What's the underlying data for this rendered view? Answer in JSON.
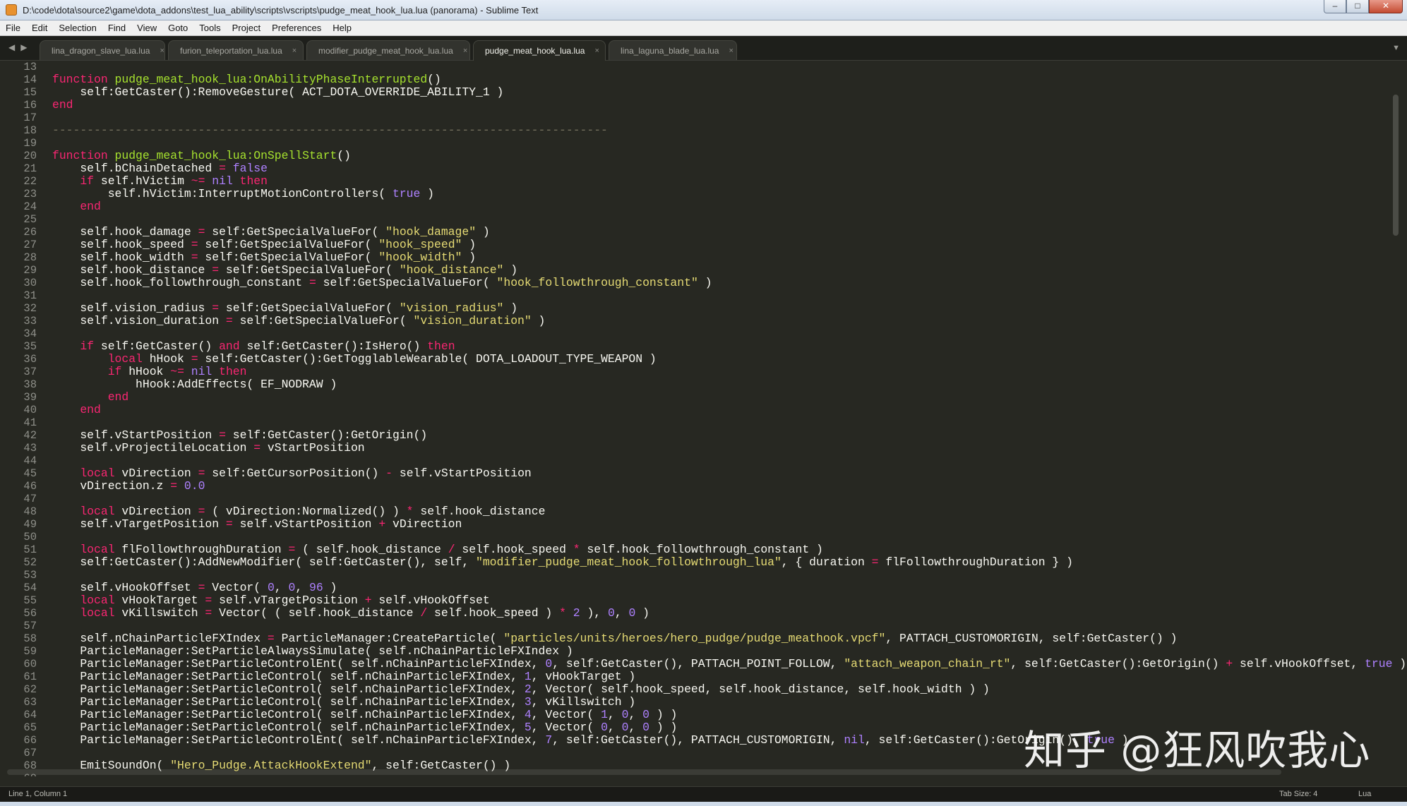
{
  "window": {
    "title": "D:\\code\\dota\\source2\\game\\dota_addons\\test_lua_ability\\scripts\\vscripts\\pudge_meat_hook_lua.lua (panorama) - Sublime Text",
    "minimize": "–",
    "maximize": "□",
    "close": "✕"
  },
  "menu": [
    "File",
    "Edit",
    "Selection",
    "Find",
    "View",
    "Goto",
    "Tools",
    "Project",
    "Preferences",
    "Help"
  ],
  "tabs": [
    {
      "label": "lina_dragon_slave_lua.lua",
      "active": false
    },
    {
      "label": "furion_teleportation_lua.lua",
      "active": false
    },
    {
      "label": "modifier_pudge_meat_hook_lua.lua",
      "active": false
    },
    {
      "label": "pudge_meat_hook_lua.lua",
      "active": true
    },
    {
      "label": "lina_laguna_blade_lua.lua",
      "active": false
    }
  ],
  "tab_close_glyph": "×",
  "tab_nav": {
    "back": "◀",
    "forward": "▶",
    "dropdown": "▼"
  },
  "colors": {
    "background": "#272822",
    "keyword": "#f92672",
    "function": "#a6e22e",
    "string": "#e6db74",
    "number": "#ae81ff",
    "comment": "#75715e",
    "text": "#f8f8f2"
  },
  "code": [
    {
      "n": 13,
      "t": []
    },
    {
      "n": 14,
      "t": [
        [
          "kw",
          "function "
        ],
        [
          "fn",
          "pudge_meat_hook_lua:OnAbilityPhaseInterrupted"
        ],
        [
          "",
          "()"
        ]
      ]
    },
    {
      "n": 15,
      "t": [
        [
          "",
          "    self:GetCaster():RemoveGesture( ACT_DOTA_OVERRIDE_ABILITY_1 )"
        ]
      ]
    },
    {
      "n": 16,
      "t": [
        [
          "kw",
          "end"
        ]
      ]
    },
    {
      "n": 17,
      "t": []
    },
    {
      "n": 18,
      "t": [
        [
          "cmt",
          "--------------------------------------------------------------------------------"
        ]
      ]
    },
    {
      "n": 19,
      "t": []
    },
    {
      "n": 20,
      "t": [
        [
          "kw",
          "function "
        ],
        [
          "fn",
          "pudge_meat_hook_lua:OnSpellStart"
        ],
        [
          "",
          "()"
        ]
      ]
    },
    {
      "n": 21,
      "t": [
        [
          "",
          "    self.bChainDetached "
        ],
        [
          "kw",
          "="
        ],
        [
          "num",
          " false"
        ]
      ]
    },
    {
      "n": 22,
      "t": [
        [
          "kw",
          "    if"
        ],
        [
          "",
          " self.hVictim "
        ],
        [
          "kw",
          "~="
        ],
        [
          "num",
          " nil"
        ],
        [
          "kw",
          " then"
        ]
      ]
    },
    {
      "n": 23,
      "t": [
        [
          "",
          "        self.hVictim:InterruptMotionControllers( "
        ],
        [
          "num",
          "true"
        ],
        [
          "",
          " )"
        ]
      ]
    },
    {
      "n": 24,
      "t": [
        [
          "kw",
          "    end"
        ]
      ]
    },
    {
      "n": 25,
      "t": []
    },
    {
      "n": 26,
      "t": [
        [
          "",
          "    self.hook_damage "
        ],
        [
          "kw",
          "="
        ],
        [
          "",
          " self:GetSpecialValueFor( "
        ],
        [
          "str",
          "\"hook_damage\""
        ],
        [
          "",
          " )"
        ]
      ]
    },
    {
      "n": 27,
      "t": [
        [
          "",
          "    self.hook_speed "
        ],
        [
          "kw",
          "="
        ],
        [
          "",
          " self:GetSpecialValueFor( "
        ],
        [
          "str",
          "\"hook_speed\""
        ],
        [
          "",
          " )"
        ]
      ]
    },
    {
      "n": 28,
      "t": [
        [
          "",
          "    self.hook_width "
        ],
        [
          "kw",
          "="
        ],
        [
          "",
          " self:GetSpecialValueFor( "
        ],
        [
          "str",
          "\"hook_width\""
        ],
        [
          "",
          " )"
        ]
      ]
    },
    {
      "n": 29,
      "t": [
        [
          "",
          "    self.hook_distance "
        ],
        [
          "kw",
          "="
        ],
        [
          "",
          " self:GetSpecialValueFor( "
        ],
        [
          "str",
          "\"hook_distance\""
        ],
        [
          "",
          " )"
        ]
      ]
    },
    {
      "n": 30,
      "t": [
        [
          "",
          "    self.hook_followthrough_constant "
        ],
        [
          "kw",
          "="
        ],
        [
          "",
          " self:GetSpecialValueFor( "
        ],
        [
          "str",
          "\"hook_followthrough_constant\""
        ],
        [
          "",
          " )"
        ]
      ]
    },
    {
      "n": 31,
      "t": []
    },
    {
      "n": 32,
      "t": [
        [
          "",
          "    self.vision_radius "
        ],
        [
          "kw",
          "="
        ],
        [
          "",
          " self:GetSpecialValueFor( "
        ],
        [
          "str",
          "\"vision_radius\""
        ],
        [
          "",
          " )"
        ]
      ]
    },
    {
      "n": 33,
      "t": [
        [
          "",
          "    self.vision_duration "
        ],
        [
          "kw",
          "="
        ],
        [
          "",
          " self:GetSpecialValueFor( "
        ],
        [
          "str",
          "\"vision_duration\""
        ],
        [
          "",
          " )"
        ]
      ]
    },
    {
      "n": 34,
      "t": []
    },
    {
      "n": 35,
      "t": [
        [
          "kw",
          "    if"
        ],
        [
          "",
          " self:GetCaster() "
        ],
        [
          "kw",
          "and"
        ],
        [
          "",
          " self:GetCaster():IsHero() "
        ],
        [
          "kw",
          "then"
        ]
      ]
    },
    {
      "n": 36,
      "t": [
        [
          "kw",
          "        local"
        ],
        [
          "",
          " hHook "
        ],
        [
          "kw",
          "="
        ],
        [
          "",
          " self:GetCaster():GetTogglableWearable( DOTA_LOADOUT_TYPE_WEAPON )"
        ]
      ]
    },
    {
      "n": 37,
      "t": [
        [
          "kw",
          "        if"
        ],
        [
          "",
          " hHook "
        ],
        [
          "kw",
          "~="
        ],
        [
          "num",
          " nil"
        ],
        [
          "kw",
          " then"
        ]
      ]
    },
    {
      "n": 38,
      "t": [
        [
          "",
          "            hHook:AddEffects( EF_NODRAW )"
        ]
      ]
    },
    {
      "n": 39,
      "t": [
        [
          "kw",
          "        end"
        ]
      ]
    },
    {
      "n": 40,
      "t": [
        [
          "kw",
          "    end"
        ]
      ]
    },
    {
      "n": 41,
      "t": []
    },
    {
      "n": 42,
      "t": [
        [
          "",
          "    self.vStartPosition "
        ],
        [
          "kw",
          "="
        ],
        [
          "",
          " self:GetCaster():GetOrigin()"
        ]
      ]
    },
    {
      "n": 43,
      "t": [
        [
          "",
          "    self.vProjectileLocation "
        ],
        [
          "kw",
          "="
        ],
        [
          "",
          " vStartPosition"
        ]
      ]
    },
    {
      "n": 44,
      "t": []
    },
    {
      "n": 45,
      "t": [
        [
          "kw",
          "    local"
        ],
        [
          "",
          " vDirection "
        ],
        [
          "kw",
          "="
        ],
        [
          "",
          " self:GetCursorPosition() "
        ],
        [
          "kw",
          "-"
        ],
        [
          "",
          " self.vStartPosition"
        ]
      ]
    },
    {
      "n": 46,
      "t": [
        [
          "",
          "    vDirection.z "
        ],
        [
          "kw",
          "="
        ],
        [
          "num",
          " 0.0"
        ]
      ]
    },
    {
      "n": 47,
      "t": []
    },
    {
      "n": 48,
      "t": [
        [
          "kw",
          "    local"
        ],
        [
          "",
          " vDirection "
        ],
        [
          "kw",
          "="
        ],
        [
          "",
          " ( vDirection:Normalized() ) "
        ],
        [
          "kw",
          "*"
        ],
        [
          "",
          " self.hook_distance"
        ]
      ]
    },
    {
      "n": 49,
      "t": [
        [
          "",
          "    self.vTargetPosition "
        ],
        [
          "kw",
          "="
        ],
        [
          "",
          " self.vStartPosition "
        ],
        [
          "kw",
          "+"
        ],
        [
          "",
          " vDirection"
        ]
      ]
    },
    {
      "n": 50,
      "t": []
    },
    {
      "n": 51,
      "t": [
        [
          "kw",
          "    local"
        ],
        [
          "",
          " flFollowthroughDuration "
        ],
        [
          "kw",
          "="
        ],
        [
          "",
          " ( self.hook_distance "
        ],
        [
          "kw",
          "/"
        ],
        [
          "",
          " self.hook_speed "
        ],
        [
          "kw",
          "*"
        ],
        [
          "",
          " self.hook_followthrough_constant )"
        ]
      ]
    },
    {
      "n": 52,
      "t": [
        [
          "",
          "    self:GetCaster():AddNewModifier( self:GetCaster(), self, "
        ],
        [
          "str",
          "\"modifier_pudge_meat_hook_followthrough_lua\""
        ],
        [
          "",
          ", { duration "
        ],
        [
          "kw",
          "="
        ],
        [
          "",
          " flFollowthroughDuration } )"
        ]
      ]
    },
    {
      "n": 53,
      "t": []
    },
    {
      "n": 54,
      "t": [
        [
          "",
          "    self.vHookOffset "
        ],
        [
          "kw",
          "="
        ],
        [
          "",
          " Vector( "
        ],
        [
          "num",
          "0"
        ],
        [
          "",
          ", "
        ],
        [
          "num",
          "0"
        ],
        [
          "",
          ", "
        ],
        [
          "num",
          "96"
        ],
        [
          "",
          " )"
        ]
      ]
    },
    {
      "n": 55,
      "t": [
        [
          "kw",
          "    local"
        ],
        [
          "",
          " vHookTarget "
        ],
        [
          "kw",
          "="
        ],
        [
          "",
          " self.vTargetPosition "
        ],
        [
          "kw",
          "+"
        ],
        [
          "",
          " self.vHookOffset"
        ]
      ]
    },
    {
      "n": 56,
      "t": [
        [
          "kw",
          "    local"
        ],
        [
          "",
          " vKillswitch "
        ],
        [
          "kw",
          "="
        ],
        [
          "",
          " Vector( ( self.hook_distance "
        ],
        [
          "kw",
          "/"
        ],
        [
          "",
          " self.hook_speed ) "
        ],
        [
          "kw",
          "*"
        ],
        [
          "num",
          " 2"
        ],
        [
          "",
          " ), "
        ],
        [
          "num",
          "0"
        ],
        [
          "",
          ", "
        ],
        [
          "num",
          "0"
        ],
        [
          "",
          " )"
        ]
      ]
    },
    {
      "n": 57,
      "t": []
    },
    {
      "n": 58,
      "t": [
        [
          "",
          "    self.nChainParticleFXIndex "
        ],
        [
          "kw",
          "="
        ],
        [
          "",
          " ParticleManager:CreateParticle( "
        ],
        [
          "str",
          "\"particles/units/heroes/hero_pudge/pudge_meathook.vpcf\""
        ],
        [
          "",
          ", PATTACH_CUSTOMORIGIN, self:GetCaster() )"
        ]
      ]
    },
    {
      "n": 59,
      "t": [
        [
          "",
          "    ParticleManager:SetParticleAlwaysSimulate( self.nChainParticleFXIndex )"
        ]
      ]
    },
    {
      "n": 60,
      "t": [
        [
          "",
          "    ParticleManager:SetParticleControlEnt( self.nChainParticleFXIndex, "
        ],
        [
          "num",
          "0"
        ],
        [
          "",
          ", self:GetCaster(), PATTACH_POINT_FOLLOW, "
        ],
        [
          "str",
          "\"attach_weapon_chain_rt\""
        ],
        [
          "",
          ", self:GetCaster():GetOrigin() "
        ],
        [
          "kw",
          "+"
        ],
        [
          "",
          " self.vHookOffset, "
        ],
        [
          "num",
          "true"
        ],
        [
          "",
          " )"
        ]
      ]
    },
    {
      "n": 61,
      "t": [
        [
          "",
          "    ParticleManager:SetParticleControl( self.nChainParticleFXIndex, "
        ],
        [
          "num",
          "1"
        ],
        [
          "",
          ", vHookTarget )"
        ]
      ]
    },
    {
      "n": 62,
      "t": [
        [
          "",
          "    ParticleManager:SetParticleControl( self.nChainParticleFXIndex, "
        ],
        [
          "num",
          "2"
        ],
        [
          "",
          ", Vector( self.hook_speed, self.hook_distance, self.hook_width ) )"
        ]
      ]
    },
    {
      "n": 63,
      "t": [
        [
          "",
          "    ParticleManager:SetParticleControl( self.nChainParticleFXIndex, "
        ],
        [
          "num",
          "3"
        ],
        [
          "",
          ", vKillswitch )"
        ]
      ]
    },
    {
      "n": 64,
      "t": [
        [
          "",
          "    ParticleManager:SetParticleControl( self.nChainParticleFXIndex, "
        ],
        [
          "num",
          "4"
        ],
        [
          "",
          ", Vector( "
        ],
        [
          "num",
          "1"
        ],
        [
          "",
          ", "
        ],
        [
          "num",
          "0"
        ],
        [
          "",
          ", "
        ],
        [
          "num",
          "0"
        ],
        [
          "",
          " ) )"
        ]
      ]
    },
    {
      "n": 65,
      "t": [
        [
          "",
          "    ParticleManager:SetParticleControl( self.nChainParticleFXIndex, "
        ],
        [
          "num",
          "5"
        ],
        [
          "",
          ", Vector( "
        ],
        [
          "num",
          "0"
        ],
        [
          "",
          ", "
        ],
        [
          "num",
          "0"
        ],
        [
          "",
          ", "
        ],
        [
          "num",
          "0"
        ],
        [
          "",
          " ) )"
        ]
      ]
    },
    {
      "n": 66,
      "t": [
        [
          "",
          "    ParticleManager:SetParticleControlEnt( self.nChainParticleFXIndex, "
        ],
        [
          "num",
          "7"
        ],
        [
          "",
          ", self:GetCaster(), PATTACH_CUSTOMORIGIN, "
        ],
        [
          "num",
          "nil"
        ],
        [
          "",
          ", self:GetCaster():GetOrigin(), "
        ],
        [
          "num",
          "true"
        ],
        [
          "",
          " )"
        ]
      ]
    },
    {
      "n": 67,
      "t": []
    },
    {
      "n": 68,
      "t": [
        [
          "",
          "    EmitSoundOn( "
        ],
        [
          "str",
          "\"Hero_Pudge.AttackHookExtend\""
        ],
        [
          "",
          ", self:GetCaster() )"
        ]
      ]
    },
    {
      "n": 69,
      "t": []
    }
  ],
  "watermark": "知乎 @狂风吹我心",
  "status": {
    "position": "Line 1, Column 1",
    "tab_size": "Tab Size: 4",
    "syntax": "Lua"
  }
}
